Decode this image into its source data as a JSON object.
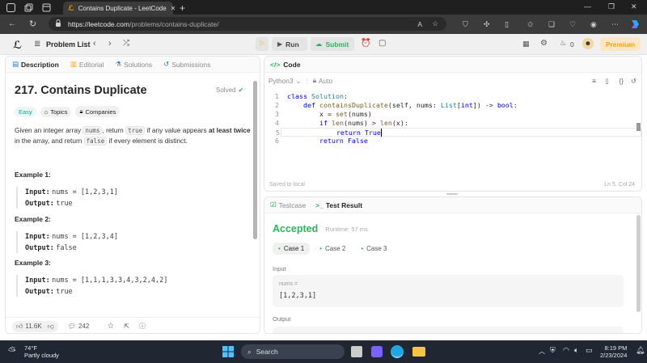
{
  "browser": {
    "tab_title": "Contains Duplicate - LeetCode",
    "url_host": "https://leetcode.com",
    "url_path": "/problems/contains-duplicate/"
  },
  "nav": {
    "problem_list": "Problem List",
    "run": "Run",
    "submit": "Submit",
    "streak_count": "0",
    "premium": "Premium"
  },
  "left_tabs": {
    "description": "Description",
    "editorial": "Editorial",
    "solutions": "Solutions",
    "submissions": "Submissions"
  },
  "problem": {
    "title": "217. Contains Duplicate",
    "solved": "Solved",
    "difficulty": "Easy",
    "topics": "Topics",
    "companies": "Companies",
    "desc_1": "Given an integer array ",
    "desc_code_1": "nums",
    "desc_2": ", return ",
    "desc_code_2": "true",
    "desc_3": " if any value appears ",
    "desc_bold": "at least twice",
    "desc_4": "in the array, and return ",
    "desc_code_3": "false",
    "desc_5": " if every element is distinct.",
    "examples": [
      {
        "title": "Example 1:",
        "input_label": "Input:",
        "input": "nums = [1,2,3,1]",
        "output_label": "Output:",
        "output": "true"
      },
      {
        "title": "Example 2:",
        "input_label": "Input:",
        "input": "nums = [1,2,3,4]",
        "output_label": "Output:",
        "output": "false"
      },
      {
        "title": "Example 3:",
        "input_label": "Input:",
        "input": "nums = [1,1,1,3,3,4,3,2,4,2]",
        "output_label": "Output:",
        "output": "true"
      }
    ],
    "likes": "11.6K",
    "comments": "242"
  },
  "code_panel": {
    "title": "Code",
    "language": "Python3",
    "auto": "Auto",
    "saved": "Saved to local",
    "cursor_pos": "Ln 5, Col 24",
    "lines": [
      {
        "n": "1"
      },
      {
        "n": "2"
      },
      {
        "n": "3"
      },
      {
        "n": "4"
      },
      {
        "n": "5"
      },
      {
        "n": "6"
      }
    ]
  },
  "result_panel": {
    "testcase_tab": "Testcase",
    "result_tab": "Test Result",
    "status": "Accepted",
    "runtime": "Runtime: 57 ms",
    "cases": [
      "Case 1",
      "Case 2",
      "Case 3"
    ],
    "input_label": "Input",
    "var_label": "nums =",
    "var_value": "[1,2,3,1]",
    "output_label": "Output"
  },
  "taskbar": {
    "temp": "74°F",
    "weather": "Partly cloudy",
    "search": "Search",
    "time": "8:19 PM",
    "date": "2/23/2024"
  },
  "colors": {
    "accepted_green": "#2db55d",
    "easy_teal": "#00af9b",
    "premium_orange": "#ffa116",
    "submit_green": "#2db55d"
  }
}
